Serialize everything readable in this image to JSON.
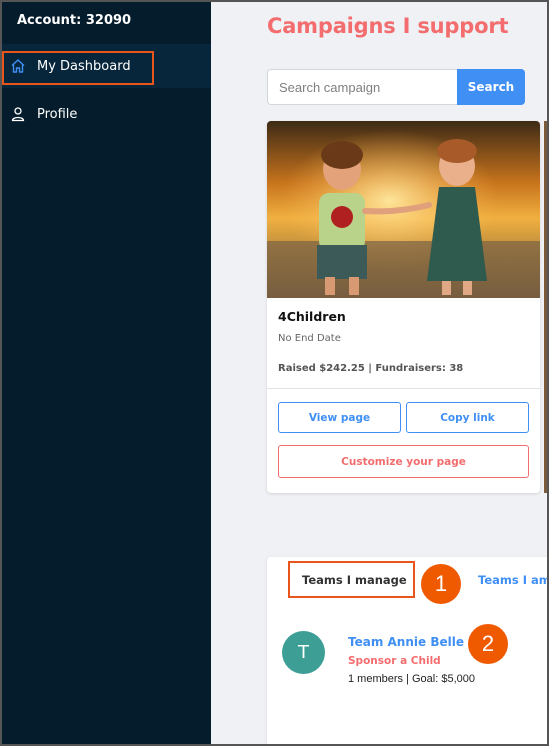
{
  "sidebar": {
    "account_label": "Account: 32090",
    "items": [
      {
        "label": "My Dashboard",
        "icon": "home-icon",
        "active": true
      },
      {
        "label": "Profile",
        "icon": "user-icon",
        "active": false
      }
    ]
  },
  "main": {
    "title": "Campaigns I support",
    "search": {
      "placeholder": "Search campaign",
      "button_label": "Search"
    },
    "campaigns": [
      {
        "name": "4Children",
        "end_date": "No End Date",
        "stats": "Raised $242.25 | Fundraisers: 38",
        "view_label": "View page",
        "copy_label": "Copy link",
        "customize_label": "Customize your page",
        "image": "two-children-holding-hands-photo"
      }
    ],
    "teams": {
      "tabs": [
        "Teams I manage",
        "Teams I am"
      ],
      "items": [
        {
          "avatar_letter": "T",
          "name": "Team Annie Belle",
          "campaign": "Sponsor a Child",
          "stats": "1 members | Goal: $5,000"
        }
      ]
    }
  },
  "annotations": {
    "step_1": "1",
    "step_2": "2",
    "highlight_color": "#e8561c",
    "badge_color": "#ef5a00"
  },
  "colors": {
    "sidebar_bg": "#041c2c",
    "accent_blue": "#3f8ff5",
    "accent_coral": "#f36d6e",
    "avatar_teal": "#3c9e95"
  }
}
